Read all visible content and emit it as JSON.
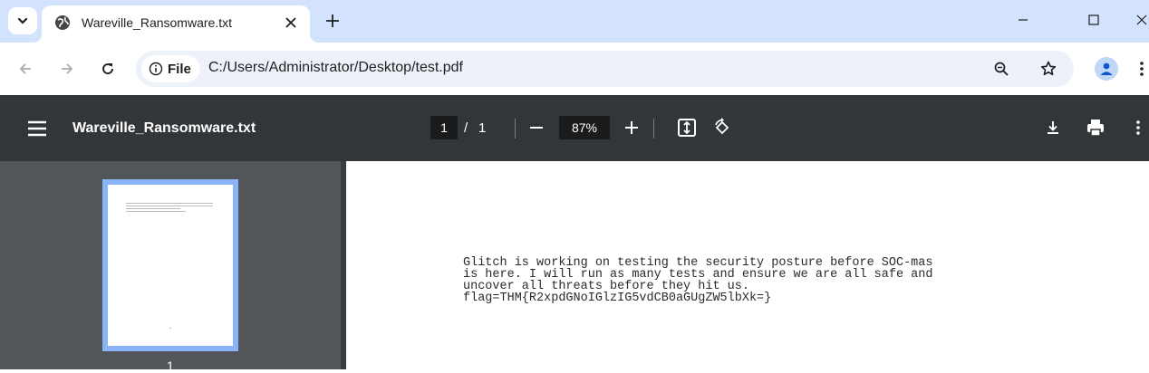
{
  "browser": {
    "tab": {
      "title": "Wareville_Ransomware.txt",
      "favicon": "globe-icon",
      "close_icon": "close-icon"
    },
    "new_tab_icon": "plus-icon",
    "window_controls": [
      "minimize-icon",
      "maximize-icon",
      "close-icon"
    ],
    "toolbar": {
      "back_icon": "arrow-left-icon",
      "forward_icon": "arrow-right-icon",
      "reload_icon": "reload-icon",
      "site_info_label": "File",
      "url": "C:/Users/Administrator/Desktop/test.pdf",
      "zoom_icon": "zoom-icon",
      "bookmark_icon": "star-icon",
      "profile_icon": "avatar-icon",
      "menu_icon": "kebab-menu-icon"
    }
  },
  "pdf_viewer": {
    "title": "Wareville_Ransomware.txt",
    "current_page": "1",
    "page_separator": "/",
    "total_pages": "1",
    "zoom_value": "87%",
    "icons": [
      "hamburger-menu-icon",
      "zoom-out-icon",
      "zoom-in-icon",
      "fit-page-icon",
      "rotate-icon",
      "download-icon",
      "print-icon",
      "more-options-icon"
    ],
    "thumbnails": [
      {
        "page_number": "1",
        "selected": true
      }
    ],
    "document": {
      "lines": [
        "Glitch is working on testing the security posture before SOC-mas",
        "is here. I will run as many tests and ensure we are all safe and",
        "uncover all threats before they hit us.",
        "flag=THM{R2xpdGNoIGlzIG5vdCB0aGUgZW5lbXk=}"
      ]
    }
  },
  "colors": {
    "tab_strip": "#d3e3fd",
    "omnibox": "#edf2fa",
    "pdf_toolbar": "#323639",
    "sidebar": "#525659",
    "thumbnail_selection": "#8ab4f8"
  }
}
